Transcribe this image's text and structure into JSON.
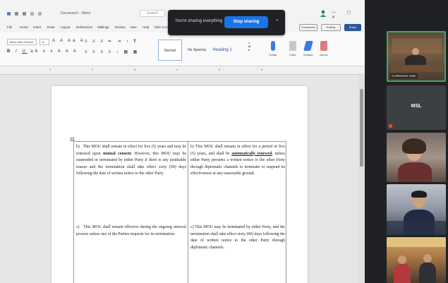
{
  "word": {
    "doc_title": "Document1 - Word",
    "search_placeholder": "Search",
    "window_controls": "— ▢ ✕",
    "ribbon_tabs": [
      "File",
      "Home",
      "Insert",
      "Draw",
      "Layout",
      "References",
      "Mailings",
      "Review",
      "View",
      "Help",
      "Table Design"
    ],
    "buttons": {
      "comments": "Comments",
      "editing": "Editing",
      "share": "Share"
    },
    "font_name": "Times New Roman",
    "font_size": "11",
    "styles": {
      "normal": "Normal",
      "no_spacing": "No Spacing",
      "heading": "Heading 1"
    },
    "ribbon_groups": {
      "dictate": "Dictate",
      "editor": "Editor",
      "designer": "Designer",
      "addins": "Add-ins"
    },
    "ruler_numbers": [
      "1",
      "2",
      "3",
      "4",
      "5",
      "6"
    ]
  },
  "share_banner": {
    "text": "You're sharing everything",
    "stop_label": "Stop sharing",
    "more_icon": "expand-icon"
  },
  "document": {
    "cell_1_1_a": "b)   This MOU shall remain in effect for five (5) years and may be renewed upon ",
    "cell_1_1_b": "mutual consent",
    "cell_1_1_c": ". However, this MOU may be suspended or terminated by either Party if there is any justifiable reason and the termination shall take effect sixty (60) days following the date of written notice to the other Party.",
    "cell_1_2_a": "b) This MOU shall remain in effect for a period of five (5) years, and shall be ",
    "cell_1_2_b": "automatically renewed",
    "cell_1_2_c": ", unless either Party presents a written notice to the other Party through diplomatic channels to terminate or suspend its effectiveness at any reasonable ground.",
    "cell_2_1": "c)   This MOU shall remain effective during the ongoing renewal process unless one of the Parties requests for its termination.",
    "cell_2_2": "c) This MOU may be terminated by either Party, and the termination shall take effect sixty (60) days following the date of written notice to the other Party through diplomatic channels."
  },
  "participants": [
    {
      "name": "Conference room",
      "kind": "video"
    },
    {
      "name": "MSL",
      "kind": "avatar",
      "muted": true
    },
    {
      "name": "",
      "kind": "video"
    },
    {
      "name": "",
      "kind": "video"
    },
    {
      "name": "",
      "kind": "video"
    }
  ],
  "colors": {
    "accent_blue": "#1a73e8",
    "word_blue": "#2b579a",
    "active_speaker": "#3fa76a",
    "mute_red": "#ea4335"
  }
}
